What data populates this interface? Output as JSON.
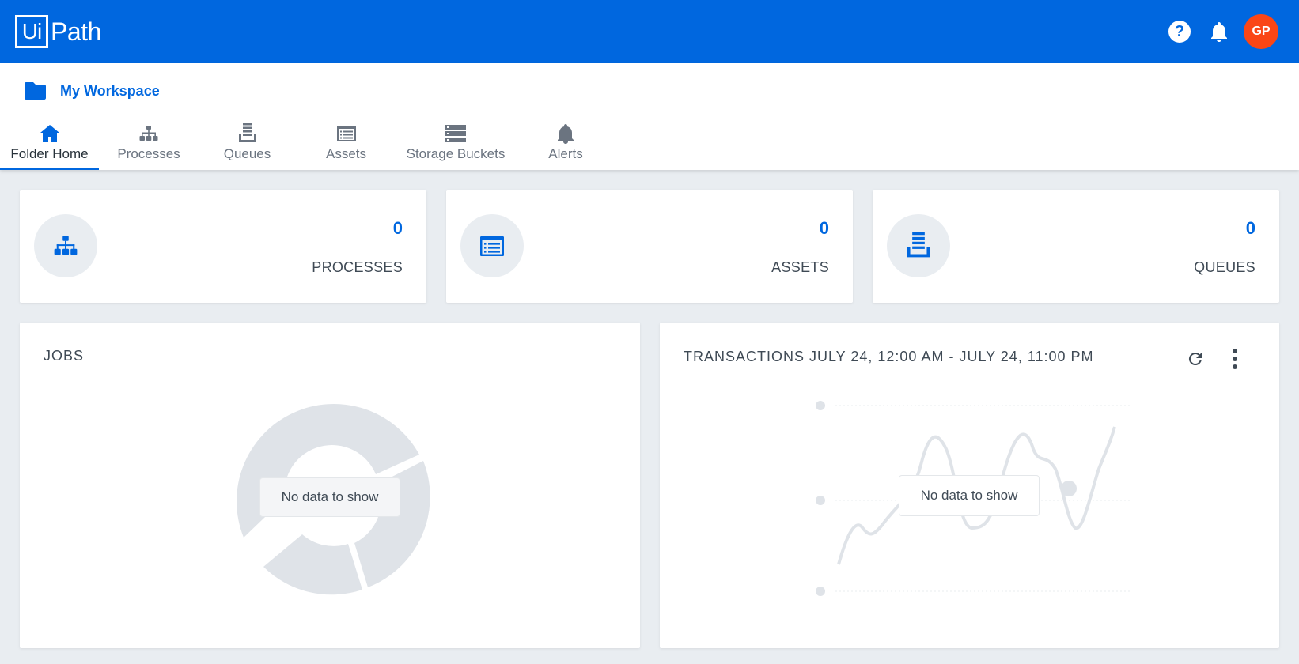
{
  "app": {
    "logo_ui": "Ui",
    "logo_path": "Path"
  },
  "topbar": {
    "help_symbol": "?",
    "avatar_initials": "GP",
    "avatar_color": "#fa4616",
    "brand_color": "#0067df"
  },
  "workspace": {
    "label": "My Workspace",
    "icon": "folder-icon"
  },
  "tabs": [
    {
      "label": "Folder Home",
      "icon": "home-icon",
      "active": true
    },
    {
      "label": "Processes",
      "icon": "sitemap-icon",
      "active": false
    },
    {
      "label": "Queues",
      "icon": "queue-icon",
      "active": false
    },
    {
      "label": "Assets",
      "icon": "asset-icon",
      "active": false
    },
    {
      "label": "Storage Buckets",
      "icon": "storage-icon",
      "active": false
    },
    {
      "label": "Alerts",
      "icon": "bell-icon",
      "active": false
    }
  ],
  "stats": [
    {
      "value": "0",
      "label": "PROCESSES",
      "icon": "sitemap-icon"
    },
    {
      "value": "0",
      "label": "ASSETS",
      "icon": "asset-icon"
    },
    {
      "value": "0",
      "label": "QUEUES",
      "icon": "queue-icon"
    }
  ],
  "jobs": {
    "title": "JOBS",
    "no_data": "No data to show"
  },
  "transactions": {
    "title": "TRANSACTIONS JULY 24, 12:00 AM - JULY 24, 11:00 PM",
    "no_data": "No data to show"
  }
}
